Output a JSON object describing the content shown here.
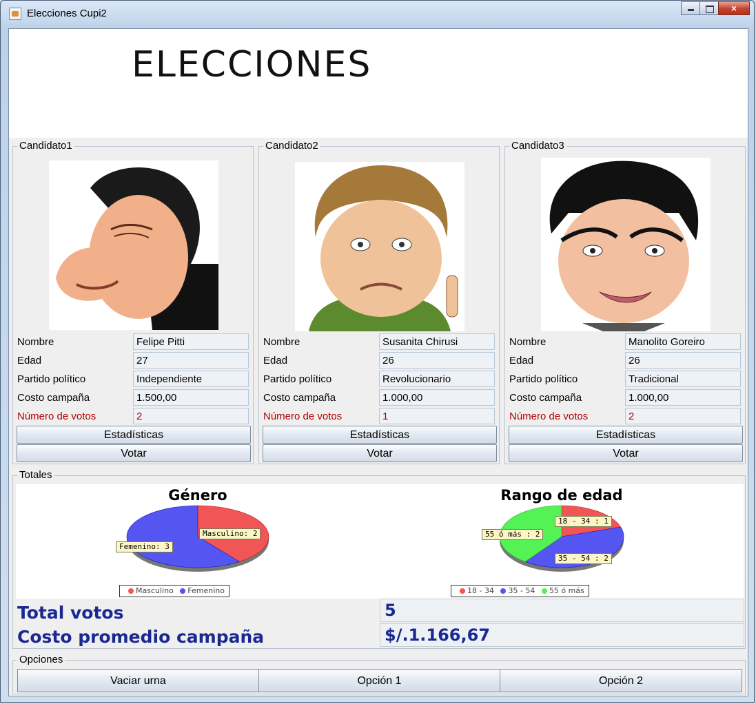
{
  "window": {
    "title": "Elecciones Cupi2",
    "close_glyph": "×"
  },
  "banner": {
    "title": "ELECCIONES"
  },
  "field_labels": {
    "nombre": "Nombre",
    "edad": "Edad",
    "partido": "Partido político",
    "costo": "Costo campaña",
    "votos": "Número de votos"
  },
  "candidates": [
    {
      "group": "Candidato1",
      "nombre": "Felipe Pitti",
      "edad": "27",
      "partido": "Independiente",
      "costo": " 1.500,00",
      "votos": "2",
      "stats_label": "Estadísticas",
      "vote_label": "Votar"
    },
    {
      "group": "Candidato2",
      "nombre": "Susanita Chirusi",
      "edad": "26",
      "partido": "Revolucionario",
      "costo": " 1.000,00",
      "votos": "1",
      "stats_label": "Estadísticas",
      "vote_label": "Votar"
    },
    {
      "group": "Candidato3",
      "nombre": "Manolito Goreiro",
      "edad": "26",
      "partido": "Tradicional",
      "costo": " 1.000,00",
      "votos": "2",
      "stats_label": "Estadísticas",
      "vote_label": "Votar"
    }
  ],
  "totals": {
    "group": "Totales",
    "total_votos_label": "Total votos",
    "total_votos_value": "5",
    "costo_promedio_label": "Costo promedio campaña",
    "costo_promedio_value": "$/.1.166,67"
  },
  "options": {
    "group": "Opciones",
    "vaciar_label": "Vaciar urna",
    "opcion1_label": "Opción 1",
    "opcion2_label": "Opción 2"
  },
  "chart_data": [
    {
      "type": "pie",
      "title": "Género",
      "categories": [
        "Masculino",
        "Femenino"
      ],
      "values": [
        2,
        3
      ],
      "slice_labels": [
        "Masculino: 2",
        "Femenino: 3"
      ],
      "colors": [
        "#f25555",
        "#5555f2"
      ],
      "legend": "bottom"
    },
    {
      "type": "pie",
      "title": "Rango de edad",
      "categories": [
        "18 - 34",
        "35 - 54",
        "55 ó más"
      ],
      "values": [
        1,
        2,
        2
      ],
      "slice_labels": [
        "18 - 34 : 1",
        "35 - 54 : 2",
        "55 ó más : 2"
      ],
      "colors": [
        "#f25555",
        "#5555f2",
        "#55f255"
      ],
      "legend": "bottom"
    }
  ]
}
